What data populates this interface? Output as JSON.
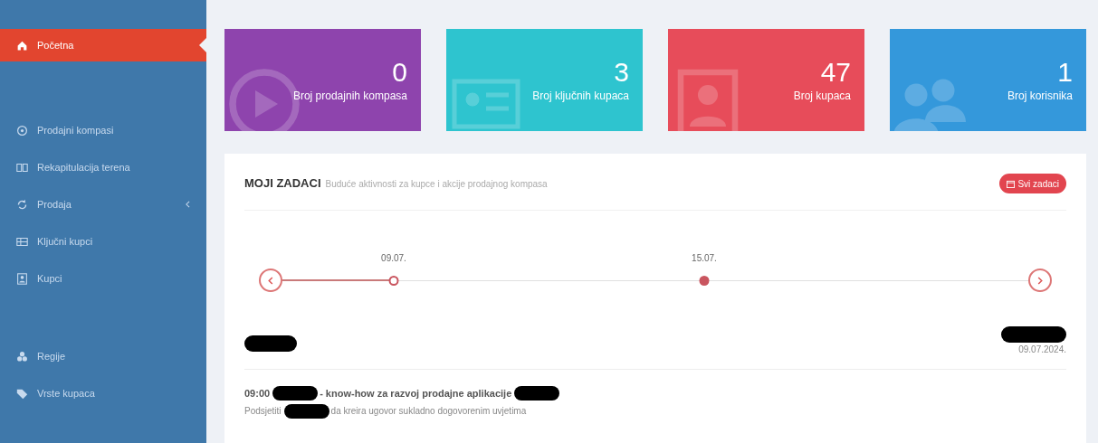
{
  "sidebar": {
    "items": [
      {
        "label": "Početna",
        "selected": true,
        "caret": false
      },
      {
        "label": "Prodajni kompasi",
        "selected": false,
        "caret": false
      },
      {
        "label": "Rekapitulacija terena",
        "selected": false,
        "caret": false
      },
      {
        "label": "Prodaja",
        "selected": false,
        "caret": true
      },
      {
        "label": "Ključni kupci",
        "selected": false,
        "caret": false
      },
      {
        "label": "Kupci",
        "selected": false,
        "caret": false
      },
      {
        "label": "Regije",
        "selected": false,
        "caret": false
      },
      {
        "label": "Vrste kupaca",
        "selected": false,
        "caret": false
      }
    ]
  },
  "stats": [
    {
      "value": "0",
      "label": "Broj prodajnih kompasa",
      "color": "#8e44ad"
    },
    {
      "value": "3",
      "label": "Broj ključnih kupaca",
      "color": "#2ec4cf"
    },
    {
      "value": "47",
      "label": "Broj kupaca",
      "color": "#e74c5a"
    },
    {
      "value": "1",
      "label": "Broj korisnika",
      "color": "#3498db"
    }
  ],
  "tasks_panel": {
    "title": "MOJI ZADACI",
    "subtitle": "Buduće aktivnosti za kupce i akcije prodajnog kompasa",
    "button": "Svi zadaci",
    "timeline": [
      {
        "date": "09.07.",
        "selected": true
      },
      {
        "date": "15.07.",
        "selected": false
      }
    ],
    "day": {
      "date": "09.07.2024."
    },
    "tasks": [
      {
        "title": [
          {
            "kind": "text",
            "text": "09:00"
          },
          {
            "kind": "redacted"
          },
          {
            "kind": "text",
            "text": "- know-how za razvoj prodajne aplikacije"
          },
          {
            "kind": "redacted"
          }
        ],
        "description": [
          {
            "kind": "text",
            "text": "Podsjetiti"
          },
          {
            "kind": "redacted"
          },
          {
            "kind": "text",
            "text": "da kreira ugovor sukladno dogovorenim uvjetima"
          }
        ]
      }
    ]
  }
}
